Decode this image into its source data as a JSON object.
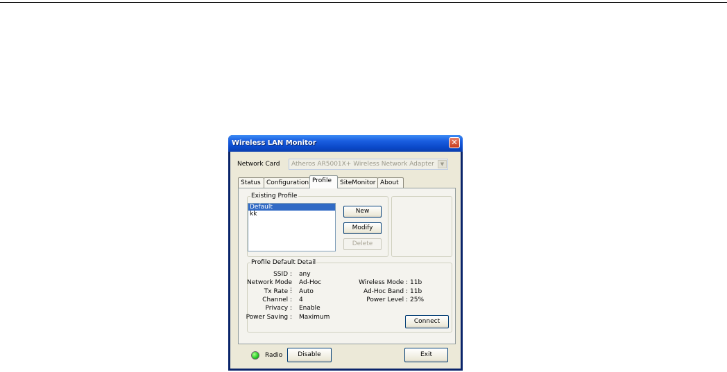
{
  "window": {
    "title": "Wireless LAN Monitor"
  },
  "network_card": {
    "label": "Network Card",
    "value": "Atheros AR5001X+ Wireless Network Adapter"
  },
  "tabs": [
    {
      "label": "Status"
    },
    {
      "label": "Configuration"
    },
    {
      "label": "Profile",
      "active": true
    },
    {
      "label": "SiteMonitor"
    },
    {
      "label": "About"
    }
  ],
  "existing_profile": {
    "legend": "Existing Profile",
    "items": [
      "Default",
      "kk"
    ],
    "selected": "Default",
    "buttons": {
      "new": "New",
      "modify": "Modify",
      "delete": "Delete"
    }
  },
  "detail": {
    "legend": "Profile  Default  Detail",
    "left": [
      {
        "label": "SSID :",
        "value": "any"
      },
      {
        "label": "Network Mode :",
        "value": "Ad-Hoc"
      },
      {
        "label": "Tx Rate :",
        "value": "Auto"
      },
      {
        "label": "Channel :",
        "value": "4"
      },
      {
        "label": "Privacy :",
        "value": "Enable"
      },
      {
        "label": "Power Saving :",
        "value": "Maximum"
      }
    ],
    "right": [
      {
        "label": "Wireless Mode :",
        "value": "11b"
      },
      {
        "label": "Ad-Hoc Band :",
        "value": "11b"
      },
      {
        "label": "Power Level :",
        "value": "25%"
      }
    ],
    "connect_label": "Connect"
  },
  "footer": {
    "radio_label": "Radio",
    "radio_status_color": "#22cc22",
    "disable_label": "Disable",
    "exit_label": "Exit"
  },
  "icons": {
    "close": "close-icon",
    "dropdown": "chevron-down-icon",
    "radio_led": "status-led-icon"
  }
}
